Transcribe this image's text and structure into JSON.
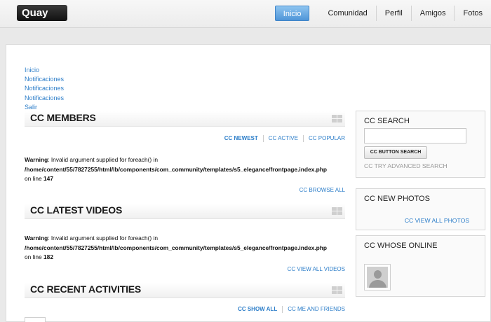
{
  "header": {
    "logo": "Quay",
    "nav": [
      "Inicio",
      "Comunidad",
      "Perfil",
      "Amigos",
      "Fotos"
    ]
  },
  "menu": [
    "Inicio",
    "Notificaciones",
    "Notificaciones",
    "Notificaciones",
    "Salir"
  ],
  "members": {
    "title": "CC MEMBERS",
    "tabs": [
      "CC NEWEST",
      "CC ACTIVE",
      "CC POPULAR"
    ],
    "warning_label": "Warning",
    "warning_text": ": Invalid argument supplied for foreach() in",
    "path": "/home/content/55/7827255/html/lb/components/com_community/templates/s5_elegance/frontpage.index.php",
    "line_prefix": "on line ",
    "line": "147",
    "link": "CC BROWSE ALL"
  },
  "videos": {
    "title": "CC LATEST VIDEOS",
    "warning_label": "Warning",
    "warning_text": ": Invalid argument supplied for foreach() in",
    "path": "/home/content/55/7827255/html/lb/components/com_community/templates/s5_elegance/frontpage.index.php",
    "line_prefix": "on line ",
    "line": "182",
    "link": "CC VIEW ALL VIDEOS"
  },
  "activities": {
    "title": "CC RECENT ACTIVITIES",
    "tabs": [
      "CC SHOW ALL",
      "CC ME AND FRIENDS"
    ]
  },
  "sidebar": {
    "search_title": "CC SEARCH",
    "search_value": "",
    "search_button": "CC BUTTON SEARCH",
    "advanced": "CC TRY ADVANCED SEARCH",
    "photos_title": "CC NEW PHOTOS",
    "photos_link": "CC VIEW ALL PHOTOS",
    "online_title": "CC WHOSE ONLINE"
  },
  "colors": {
    "link": "#2d7ec9",
    "nav_active": "#4f95d8"
  }
}
